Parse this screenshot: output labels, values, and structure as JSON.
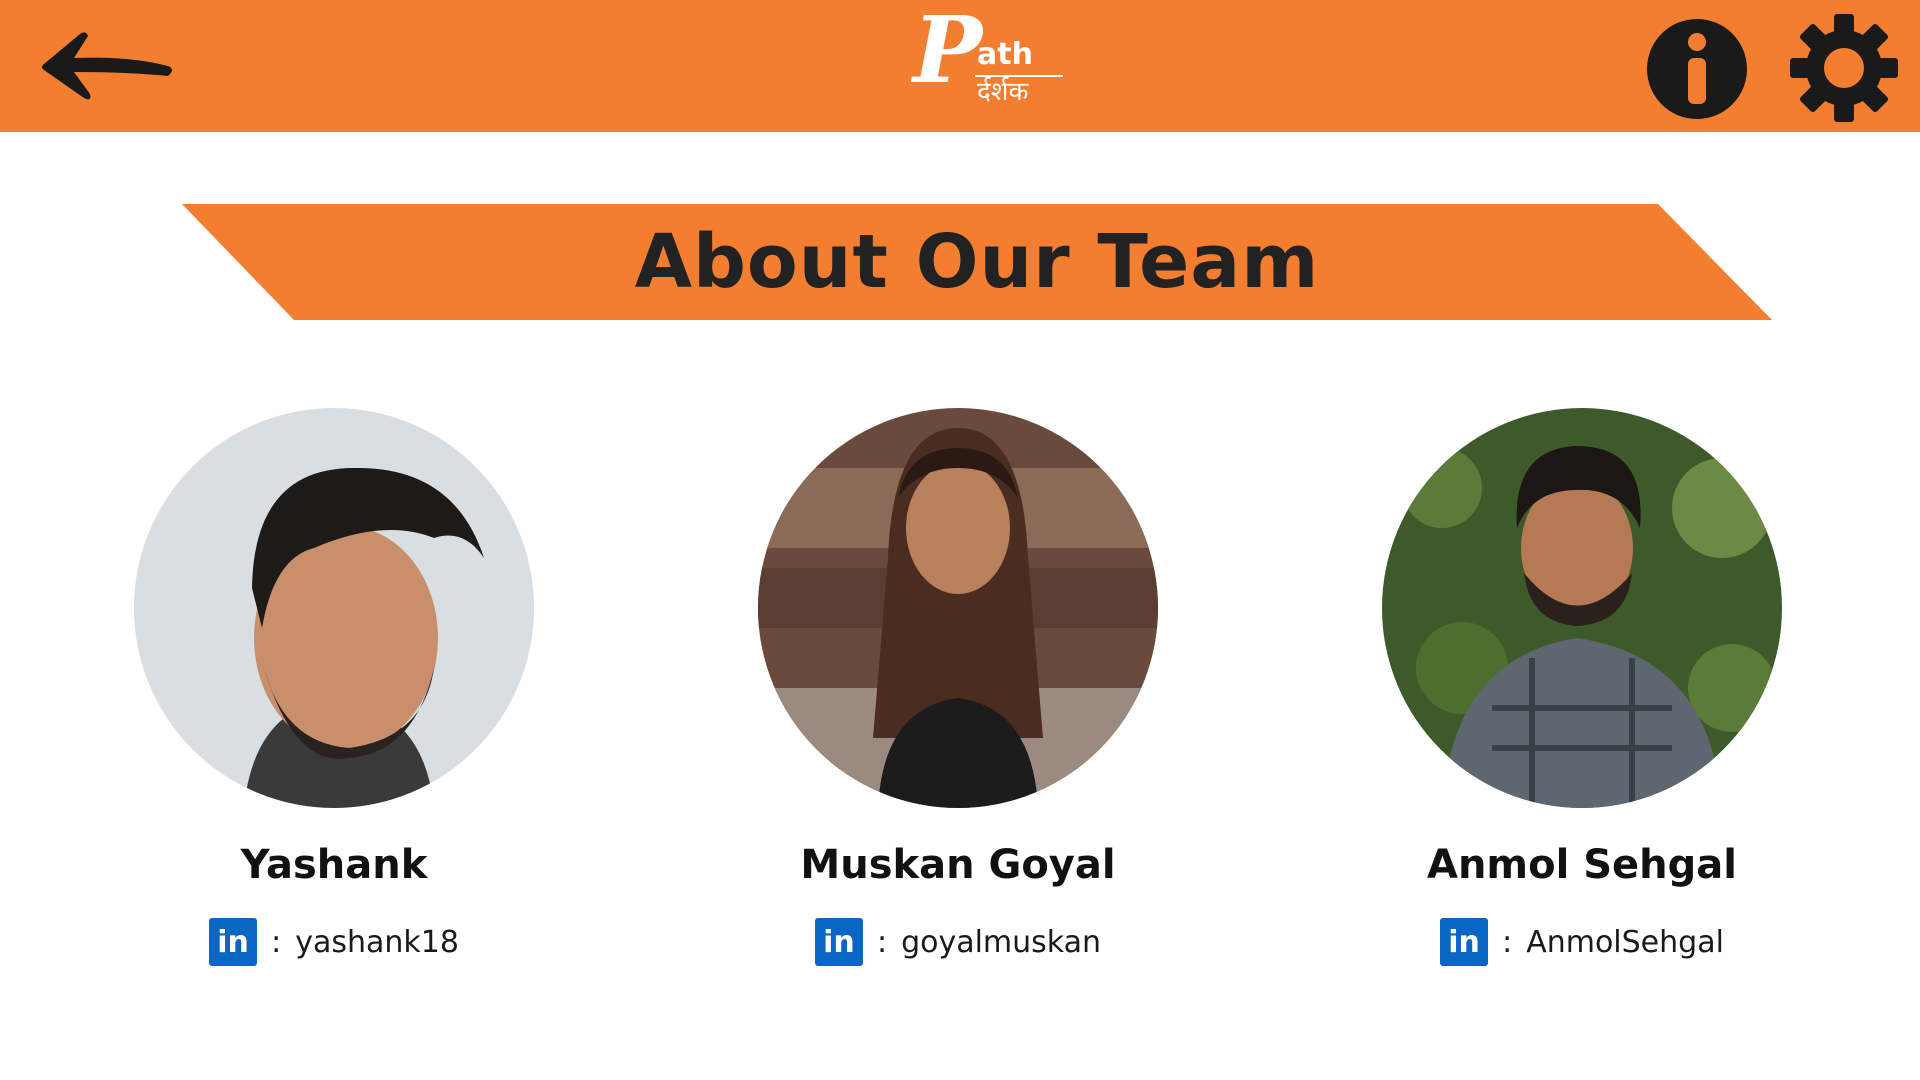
{
  "header": {
    "logo": {
      "letter": "P",
      "text": "ath",
      "subtitle": "र्दर्शक"
    },
    "back_icon": "arrow-left-icon",
    "info_icon": "info-icon",
    "settings_icon": "gear-icon"
  },
  "banner": {
    "title": "About Our Team"
  },
  "team": [
    {
      "name": "Yashank",
      "linkedin_icon": "in",
      "separator": ":",
      "handle": "yashank18"
    },
    {
      "name": "Muskan Goyal",
      "linkedin_icon": "in",
      "separator": ":",
      "handle": "goyalmuskan"
    },
    {
      "name": "Anmol Sehgal",
      "linkedin_icon": "in",
      "separator": ":",
      "handle": "AnmolSehgal"
    }
  ],
  "colors": {
    "brand": "#F47E30",
    "linkedin": "#0A66C2",
    "text": "#222222",
    "icon": "#1a1a1a"
  }
}
